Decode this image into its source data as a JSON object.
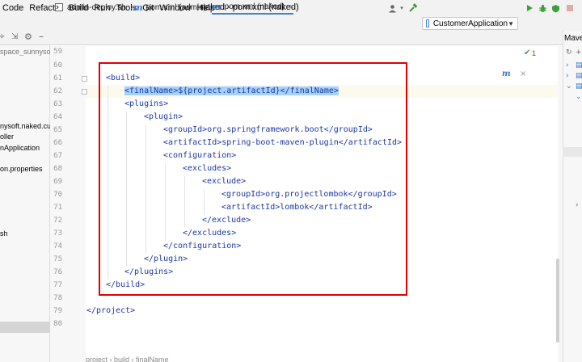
{
  "menu": {
    "items": [
      "Code",
      "Refactor",
      "Build",
      "Run",
      "Tools",
      "Git",
      "Window",
      "Help"
    ]
  },
  "window": {
    "title": "naked - pom.xml (naked)"
  },
  "toolbar": {
    "run_config": "CustomerApplication",
    "icons": [
      "user-icon",
      "build-hammer-icon",
      "run-icon",
      "debug-icon",
      "coverage-icon",
      "stop-icon"
    ]
  },
  "tabs": [
    {
      "label": "admin-deploy.sh",
      "icon": "shell-script-icon",
      "active": false
    },
    {
      "label": "pom.xml (admin)",
      "icon": "maven-icon",
      "active": false
    },
    {
      "label": "pom.xml (naked)",
      "icon": "maven-icon",
      "active": true
    }
  ],
  "project_panel": {
    "items": [
      "space_sunnysoft",
      "nysoft.naked.cus",
      "oller",
      "nApplication",
      "on.properties",
      "sh"
    ]
  },
  "editor": {
    "lines": [
      {
        "no": "59",
        "text": ""
      },
      {
        "no": "60",
        "text": ""
      },
      {
        "no": "61",
        "text": "<build>"
      },
      {
        "no": "62",
        "text": "<finalName>${project.artifactId}</finalName>"
      },
      {
        "no": "63",
        "text": "<plugins>"
      },
      {
        "no": "64",
        "text": "<plugin>"
      },
      {
        "no": "65",
        "text": "<groupId>org.springframework.boot</groupId>"
      },
      {
        "no": "66",
        "text": "<artifactId>spring-boot-maven-plugin</artifactId>"
      },
      {
        "no": "67",
        "text": "<configuration>"
      },
      {
        "no": "68",
        "text": "<excludes>"
      },
      {
        "no": "69",
        "text": "<exclude>"
      },
      {
        "no": "70",
        "text": "<groupId>org.projectlombok</groupId>"
      },
      {
        "no": "71",
        "text": "<artifactId>lombok</artifactId>"
      },
      {
        "no": "72",
        "text": "</exclude>"
      },
      {
        "no": "73",
        "text": "</excludes>"
      },
      {
        "no": "74",
        "text": "</configuration>"
      },
      {
        "no": "75",
        "text": "</plugin>"
      },
      {
        "no": "76",
        "text": "</plugins>"
      },
      {
        "no": "77",
        "text": "</build>"
      },
      {
        "no": "78",
        "text": ""
      },
      {
        "no": "79",
        "text": "</project>"
      },
      {
        "no": "80",
        "text": ""
      }
    ],
    "inspection_count": "1"
  },
  "right_panel": {
    "title": "Mave"
  },
  "breadcrumb": {
    "text": "project  ›  build  ›  finalName"
  }
}
